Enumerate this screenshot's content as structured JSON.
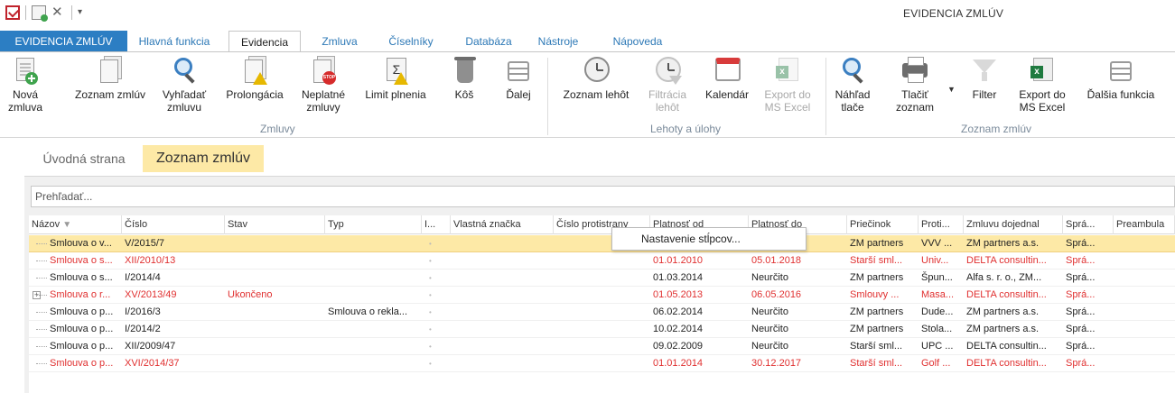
{
  "window": {
    "title": "EVIDENCIA ZMLÚV"
  },
  "app_tab": "EVIDENCIA ZMLÚV",
  "ribbon_tabs": [
    "Hlavná funkcia",
    "Evidencia",
    "Zmluva",
    "Číselníky",
    "Databáza",
    "Nástroje",
    "Nápoveda"
  ],
  "active_ribbon_tab": "Evidencia",
  "ribbon": {
    "zmluvy": {
      "group_label": "Zmluvy",
      "new": "Nová\nzmluva",
      "list": "Zoznam zmlúv",
      "search": "Vyhľadať\nzmluvu",
      "prolong": "Prolongácia",
      "invalid": "Neplatné\nzmluvy",
      "limit": "Limit plnenia",
      "trash": "Kôš",
      "more": "Ďalej"
    },
    "lehoty": {
      "group_label": "Lehoty a úlohy",
      "list": "Zoznam lehôt",
      "filter": "Filtrácia\nlehôt",
      "calendar": "Kalendár",
      "export": "Export do\nMS Excel"
    },
    "zoznam": {
      "group_label": "Zoznam zmlúv",
      "preview": "Náhľad\ntlače",
      "print": "Tlačiť\nzoznam",
      "filter": "Filter",
      "export": "Export do\nMS Excel",
      "more": "Ďalšia funkcia"
    }
  },
  "doc_tabs": [
    "Úvodná strana",
    "Zoznam zmlúv"
  ],
  "active_doc_tab": "Zoznam zmlúv",
  "search": {
    "placeholder": "Prehľadať..."
  },
  "grid": {
    "columns": [
      "Názov",
      "Číslo",
      "Stav",
      "Typ",
      "I...",
      "Vlastná značka",
      "Číslo protistrany",
      "Platnosť od",
      "Platnosť do",
      "Priečinok",
      "Proti...",
      "Zmluvu dojednal",
      "Sprá...",
      "Preambula"
    ],
    "rows": [
      {
        "nazov": "Smlouva o v...",
        "cislo": "V/2015/7",
        "stav": "",
        "typ": "",
        "i": "•",
        "od": "",
        "do": "",
        "priecinok": "ZM partners",
        "proti": "VVV ...",
        "dojednal": "ZM partners a.s.",
        "spravca": "Sprá...",
        "red": false,
        "selected": true,
        "expand": false
      },
      {
        "nazov": "Smlouva o s...",
        "cislo": "XII/2010/13",
        "stav": "",
        "typ": "",
        "i": "•",
        "od": "01.01.2010",
        "do": "05.01.2018",
        "priecinok": "Starší sml...",
        "proti": "Univ...",
        "dojednal": "DELTA consultin...",
        "spravca": "Sprá...",
        "red": true,
        "selected": false,
        "expand": false
      },
      {
        "nazov": "Smlouva o s...",
        "cislo": "I/2014/4",
        "stav": "",
        "typ": "",
        "i": "•",
        "od": "01.03.2014",
        "do": "Neurčito",
        "priecinok": "ZM partners",
        "proti": "Špun...",
        "dojednal": "Alfa s. r. o., ZM...",
        "spravca": "Sprá...",
        "red": false,
        "selected": false,
        "expand": false
      },
      {
        "nazov": "Smlouva o r...",
        "cislo": "XV/2013/49",
        "stav": "Ukončeno",
        "typ": "",
        "i": "•",
        "od": "01.05.2013",
        "do": "06.05.2016",
        "priecinok": "Smlouvy ...",
        "proti": "Masa...",
        "dojednal": "DELTA consultin...",
        "spravca": "Sprá...",
        "red": true,
        "selected": false,
        "expand": true
      },
      {
        "nazov": "Smlouva o p...",
        "cislo": "I/2016/3",
        "stav": "",
        "typ": "Smlouva o rekla...",
        "i": "•",
        "od": "06.02.2014",
        "do": "Neurčito",
        "priecinok": "ZM partners",
        "proti": "Dude...",
        "dojednal": "ZM partners a.s.",
        "spravca": "Sprá...",
        "red": false,
        "selected": false,
        "expand": false
      },
      {
        "nazov": "Smlouva o p...",
        "cislo": "I/2014/2",
        "stav": "",
        "typ": "",
        "i": "•",
        "od": "10.02.2014",
        "do": "Neurčito",
        "priecinok": "ZM partners",
        "proti": "Stola...",
        "dojednal": "ZM partners a.s.",
        "spravca": "Sprá...",
        "red": false,
        "selected": false,
        "expand": false
      },
      {
        "nazov": "Smlouva o p...",
        "cislo": "XII/2009/47",
        "stav": "",
        "typ": "",
        "i": "•",
        "od": "09.02.2009",
        "do": "Neurčito",
        "priecinok": "Starší sml...",
        "proti": "UPC ...",
        "dojednal": "DELTA consultin...",
        "spravca": "Sprá...",
        "red": false,
        "selected": false,
        "expand": false
      },
      {
        "nazov": "Smlouva o p...",
        "cislo": "XVI/2014/37",
        "stav": "",
        "typ": "",
        "i": "•",
        "od": "01.01.2014",
        "do": "30.12.2017",
        "priecinok": "Starší sml...",
        "proti": "Golf ...",
        "dojednal": "DELTA consultin...",
        "spravca": "Sprá...",
        "red": true,
        "selected": false,
        "expand": false
      }
    ]
  },
  "context_menu": {
    "item": "Nastavenie stĺpcov..."
  },
  "colors": {
    "accent": "#2c7ec3",
    "selected_row": "#fde9a6",
    "expired_text": "#e03030"
  }
}
